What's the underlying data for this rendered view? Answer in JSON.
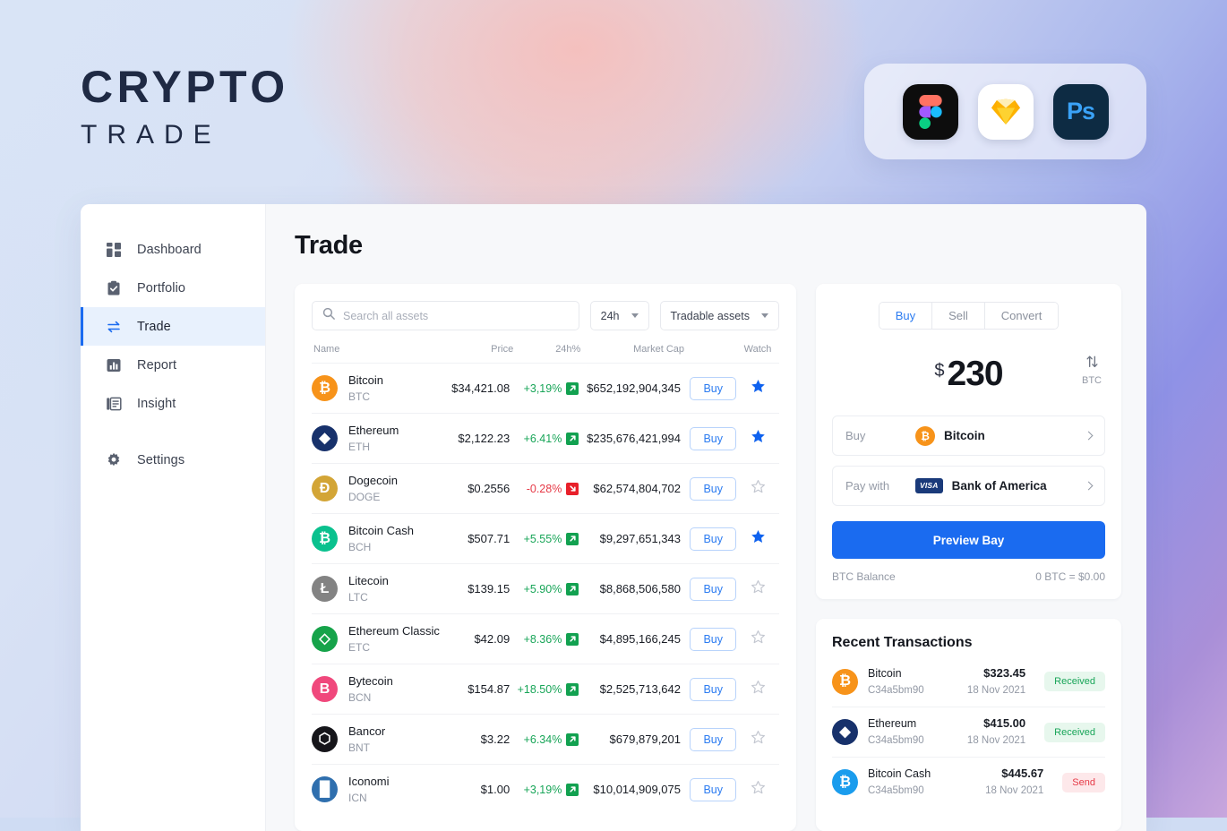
{
  "brand": {
    "line1": "CRYPTO",
    "line2": "TRADE"
  },
  "app_badges": [
    {
      "name": "figma-app-icon",
      "label": "Figma"
    },
    {
      "name": "sketch-app-icon",
      "label": "Sketch"
    },
    {
      "name": "photoshop-app-icon",
      "label": "Ps"
    }
  ],
  "sidebar": {
    "items": [
      {
        "label": "Dashboard",
        "icon": "dashboard-icon",
        "active": false
      },
      {
        "label": "Portfolio",
        "icon": "clipboard-check-icon",
        "active": false
      },
      {
        "label": "Trade",
        "icon": "exchange-arrows-icon",
        "active": true
      },
      {
        "label": "Report",
        "icon": "bar-chart-icon",
        "active": false
      },
      {
        "label": "Insight",
        "icon": "document-lines-icon",
        "active": false
      },
      {
        "label": "Settings",
        "icon": "gear-icon",
        "active": false
      }
    ]
  },
  "main": {
    "page_title": "Trade",
    "search": {
      "placeholder": "Search all assets",
      "value": "",
      "icon": "search-icon"
    },
    "filters": [
      {
        "label": "24h",
        "name": "timeframe-dropdown"
      },
      {
        "label": "Tradable assets",
        "name": "asset-type-dropdown"
      }
    ],
    "table": {
      "headers": [
        "Name",
        "Price",
        "24h%",
        "Market Cap",
        "",
        "Watch"
      ],
      "buy_label": "Buy",
      "rows": [
        {
          "name": "Bitcoin",
          "symbol": "BTC",
          "price": "$34,421.08",
          "change": "+3,19%",
          "dir": "up",
          "market_cap": "$652,192,904,345",
          "watched": true,
          "color": "#f7931a",
          "glyph": "₿"
        },
        {
          "name": "Ethereum",
          "symbol": "ETH",
          "price": "$2,122.23",
          "change": "+6.41%",
          "dir": "up",
          "market_cap": "$235,676,421,994",
          "watched": true,
          "color": "#17316b",
          "glyph": "◆"
        },
        {
          "name": "Dogecoin",
          "symbol": "DOGE",
          "price": "$0.2556",
          "change": "-0.28%",
          "dir": "down",
          "market_cap": "$62,574,804,702",
          "watched": false,
          "color": "#d3a536",
          "glyph": "Ð"
        },
        {
          "name": "Bitcoin Cash",
          "symbol": "BCH",
          "price": "$507.71",
          "change": "+5.55%",
          "dir": "up",
          "market_cap": "$9,297,651,343",
          "watched": true,
          "color": "#0ac18e",
          "glyph": "₿"
        },
        {
          "name": "Litecoin",
          "symbol": "LTC",
          "price": "$139.15",
          "change": "+5.90%",
          "dir": "up",
          "market_cap": "$8,868,506,580",
          "watched": false,
          "color": "#838383",
          "glyph": "Ł"
        },
        {
          "name": "Ethereum Classic",
          "symbol": "ETC",
          "price": "$42.09",
          "change": "+8.36%",
          "dir": "up",
          "market_cap": "$4,895,166,245",
          "watched": false,
          "color": "#16a34a",
          "glyph": "◇"
        },
        {
          "name": "Bytecoin",
          "symbol": "BCN",
          "price": "$154.87",
          "change": "+18.50%",
          "dir": "up",
          "market_cap": "$2,525,713,642",
          "watched": false,
          "color": "#f0487c",
          "glyph": "Β"
        },
        {
          "name": "Bancor",
          "symbol": "BNT",
          "price": "$3.22",
          "change": "+6.34%",
          "dir": "up",
          "market_cap": "$679,879,201",
          "watched": false,
          "color": "#16151a",
          "glyph": "⬡"
        },
        {
          "name": "Iconomi",
          "symbol": "ICN",
          "price": "$1.00",
          "change": "+3,19%",
          "dir": "up",
          "market_cap": "$10,014,909,075",
          "watched": false,
          "color": "#2f6fae",
          "glyph": "█"
        }
      ]
    }
  },
  "trade_panel": {
    "tabs": [
      {
        "label": "Buy",
        "active": true
      },
      {
        "label": "Sell",
        "active": false
      },
      {
        "label": "Convert",
        "active": false
      }
    ],
    "amount": {
      "currency_symbol": "$",
      "value": "230",
      "swap_currency": "BTC",
      "swap_icon": "swap-vertical-icon"
    },
    "buy_row": {
      "label": "Buy",
      "value": "Bitcoin",
      "icon": "bitcoin-icon"
    },
    "pay_row": {
      "label": "Pay with",
      "value": "Bank of America",
      "card": "VISA"
    },
    "preview_button": "Preview Bay",
    "balance_label": "BTC Balance",
    "balance_value": "0 BTC = $0.00"
  },
  "transactions": {
    "title": "Recent Transactions",
    "items": [
      {
        "name": "Bitcoin",
        "address": "C34a5bm90",
        "amount": "$323.45",
        "date": "18 Nov 2021",
        "status": "Received",
        "status_type": "received",
        "color": "#f7931a",
        "glyph": "₿"
      },
      {
        "name": "Ethereum",
        "address": "C34a5bm90",
        "amount": "$415.00",
        "date": "18 Nov 2021",
        "status": "Received",
        "status_type": "received",
        "color": "#17316b",
        "glyph": "◆"
      },
      {
        "name": "Bitcoin Cash",
        "address": "C34a5bm90",
        "amount": "$445.67",
        "date": "18 Nov 2021",
        "status": "Send",
        "status_type": "send",
        "color": "#1a9ced",
        "glyph": "₿"
      }
    ]
  },
  "colors": {
    "accent_blue": "#1a6bf0",
    "link_blue": "#2c7cf1",
    "up_green": "#18a558",
    "down_red": "#e63946",
    "navy": "#1f2a44"
  }
}
